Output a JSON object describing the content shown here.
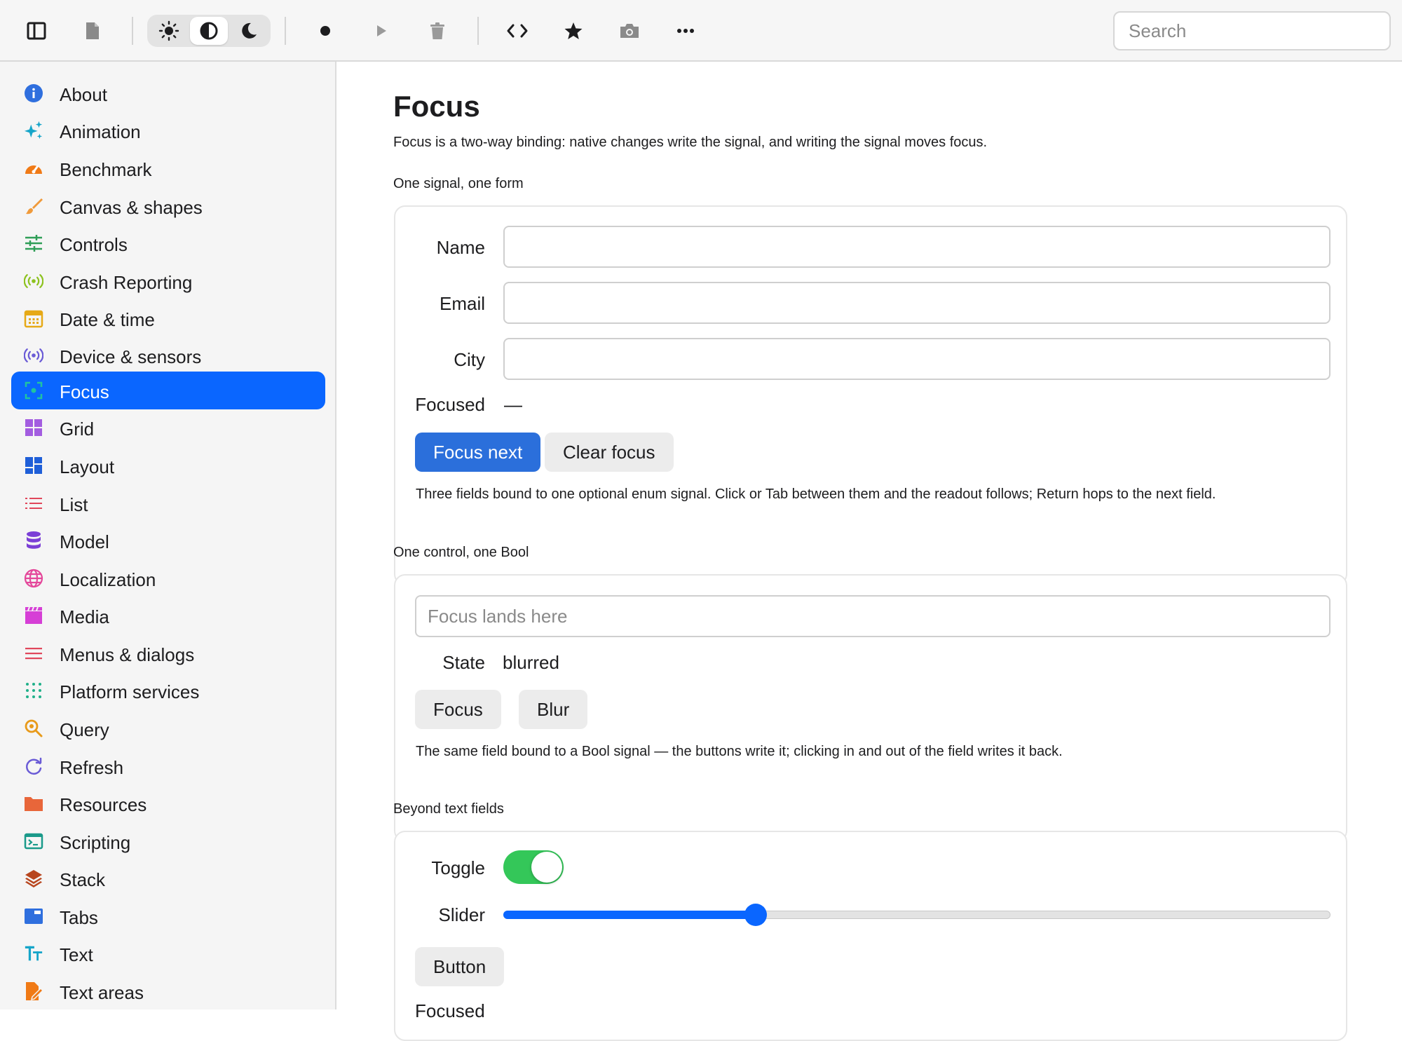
{
  "toolbar": {
    "buttons": [
      {
        "id": "sidebar-toggle",
        "icon": "sidebar-icon"
      },
      {
        "id": "document",
        "icon": "document-icon"
      },
      {
        "id": "record",
        "icon": "record-icon"
      },
      {
        "id": "play",
        "icon": "play-icon"
      },
      {
        "id": "trash",
        "icon": "trash-icon"
      },
      {
        "id": "code",
        "icon": "code-icon"
      },
      {
        "id": "star",
        "icon": "star-icon"
      },
      {
        "id": "camera",
        "icon": "camera-icon"
      },
      {
        "id": "more",
        "icon": "more-icon"
      }
    ],
    "appearance": {
      "options": [
        "light",
        "auto",
        "dark"
      ],
      "selected": "auto"
    },
    "search_placeholder": "Search"
  },
  "sidebar": {
    "selected": "Focus",
    "items": [
      {
        "label": "About",
        "icon": "info-icon",
        "color": "#2f6fde"
      },
      {
        "label": "Animation",
        "icon": "sparkles-icon",
        "color": "#16a5c9"
      },
      {
        "label": "Benchmark",
        "icon": "gauge-icon",
        "color": "#f07a16"
      },
      {
        "label": "Canvas & shapes",
        "icon": "brush-icon",
        "color": "#f09a3a"
      },
      {
        "label": "Controls",
        "icon": "sliders-icon",
        "color": "#2f9e57"
      },
      {
        "label": "Crash Reporting",
        "icon": "broadcast-icon",
        "color": "#8dc21f"
      },
      {
        "label": "Date & time",
        "icon": "calendar-icon",
        "color": "#e6a916"
      },
      {
        "label": "Device & sensors",
        "icon": "sensor-icon",
        "color": "#6a5bd6"
      },
      {
        "label": "Focus",
        "icon": "focus-icon",
        "color": "#20c3a0"
      },
      {
        "label": "Grid",
        "icon": "grid-icon",
        "color": "#a35de0"
      },
      {
        "label": "Layout",
        "icon": "layout-icon",
        "color": "#1f5fd8"
      },
      {
        "label": "List",
        "icon": "list-icon",
        "color": "#e0475b"
      },
      {
        "label": "Model",
        "icon": "database-icon",
        "color": "#7b3fd6"
      },
      {
        "label": "Localization",
        "icon": "globe-icon",
        "color": "#e4479a"
      },
      {
        "label": "Media",
        "icon": "clapper-icon",
        "color": "#d63fd6"
      },
      {
        "label": "Menus & dialogs",
        "icon": "menu-icon",
        "color": "#e0475b"
      },
      {
        "label": "Platform services",
        "icon": "dots-grid-icon",
        "color": "#20b08a"
      },
      {
        "label": "Query",
        "icon": "magnifier-icon",
        "color": "#e89a1a"
      },
      {
        "label": "Refresh",
        "icon": "refresh-icon",
        "color": "#6a5bd6"
      },
      {
        "label": "Resources",
        "icon": "folder-icon",
        "color": "#e8663a"
      },
      {
        "label": "Scripting",
        "icon": "terminal-icon",
        "color": "#1a9a8a"
      },
      {
        "label": "Stack",
        "icon": "stack-icon",
        "color": "#b8461f"
      },
      {
        "label": "Tabs",
        "icon": "tabs-icon",
        "color": "#2f6fde"
      },
      {
        "label": "Text",
        "icon": "text-icon",
        "color": "#16a5c9"
      },
      {
        "label": "Text areas",
        "icon": "edit-doc-icon",
        "color": "#f07a16"
      }
    ]
  },
  "main": {
    "title": "Focus",
    "description": "Focus is a two-way binding: native changes write the signal, and writing the signal moves focus.",
    "form_section": {
      "heading": "One signal, one form",
      "fields": [
        {
          "label": "Name",
          "value": ""
        },
        {
          "label": "Email",
          "value": ""
        },
        {
          "label": "City",
          "value": ""
        }
      ],
      "focused_label": "Focused",
      "focused_value": "—",
      "focus_next": "Focus next",
      "clear_focus": "Clear focus",
      "help": "Three fields bound to one optional enum signal. Click or Tab between them and the readout follows; Return hops to the next field."
    },
    "bool_section": {
      "heading": "One control, one Bool",
      "placeholder": "Focus lands here",
      "state_label": "State",
      "state_value": "blurred",
      "focus_button": "Focus",
      "blur_button": "Blur",
      "help": "The same field bound to a Bool signal — the buttons write it; clicking in and out of the field writes it back."
    },
    "beyond_section": {
      "heading": "Beyond text fields",
      "toggle_label": "Toggle",
      "toggle_on": true,
      "slider_label": "Slider",
      "slider_value": 0.305,
      "button_label": "Button",
      "focused_label": "Focused"
    }
  }
}
